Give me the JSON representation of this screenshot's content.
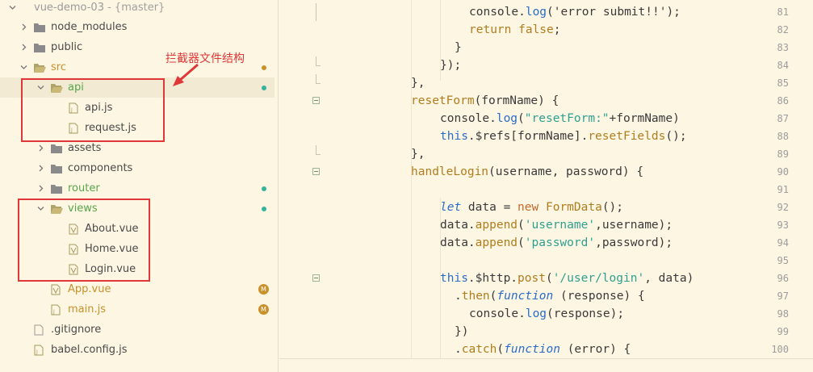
{
  "explorer": {
    "project": "vue-demo-03",
    "branch": " - {master}",
    "items": [
      {
        "label": "node_modules"
      },
      {
        "label": "public"
      },
      {
        "label": "src"
      },
      {
        "label": "api"
      },
      {
        "label": "api.js"
      },
      {
        "label": "request.js"
      },
      {
        "label": "assets"
      },
      {
        "label": "components"
      },
      {
        "label": "router"
      },
      {
        "label": "views"
      },
      {
        "label": "About.vue"
      },
      {
        "label": "Home.vue"
      },
      {
        "label": "Login.vue"
      },
      {
        "label": "App.vue"
      },
      {
        "label": "main.js"
      },
      {
        "label": ".gitignore"
      },
      {
        "label": "babel.config.js"
      }
    ],
    "badge_modified": "M",
    "annotation": "拦截器文件结构"
  },
  "editor": {
    "lines": [
      {
        "n": "81"
      },
      {
        "n": "82"
      },
      {
        "n": "83"
      },
      {
        "n": "84"
      },
      {
        "n": "85"
      },
      {
        "n": "86"
      },
      {
        "n": "87"
      },
      {
        "n": "88"
      },
      {
        "n": "89"
      },
      {
        "n": "90"
      },
      {
        "n": "91"
      },
      {
        "n": "92"
      },
      {
        "n": "93"
      },
      {
        "n": "94"
      },
      {
        "n": "95"
      },
      {
        "n": "96"
      },
      {
        "n": "97"
      },
      {
        "n": "98"
      },
      {
        "n": "99"
      },
      {
        "n": "100"
      }
    ],
    "tokens": {
      "l81_console": "console.",
      "l81_log": "log",
      "l81_str": "('error submit!!');",
      "l82_ret": "return ",
      "l82_false": "false",
      "l82_semi": ";",
      "l83": "}",
      "l84": "});",
      "l85": "},",
      "l86_fn": "resetForm",
      "l86_rest": "(formName) {",
      "l87_console": "console.",
      "l87_log": "log",
      "l87_open": "(",
      "l87_str": "\"resetForm:\"",
      "l87_rest": "+formName)",
      "l88_this": "this",
      "l88_mid": ".$refs[formName].",
      "l88_method": "resetFields",
      "l88_end": "();",
      "l89": "},",
      "l90_fn": "handleLogin",
      "l90_rest": "(username, password) {",
      "l92_let": "let",
      "l92_mid": " data = ",
      "l92_new": "new",
      "l92_cls": " FormData",
      "l92_end": "();",
      "l93_a": "data.",
      "l93_m": "append",
      "l93_o": "(",
      "l93_s": "'username'",
      "l93_e": ",username);",
      "l94_a": "data.",
      "l94_m": "append",
      "l94_o": "(",
      "l94_s": "'password'",
      "l94_e": ",password);",
      "l96_this": "this",
      "l96_mid": ".$http.",
      "l96_post": "post",
      "l96_o": "(",
      "l96_s": "'/user/login'",
      "l96_e": ", data)",
      "l97_dot": ".",
      "l97_then": "then",
      "l97_o": "(",
      "l97_fn": "function",
      "l97_e": " (response) {",
      "l98_c": "console.",
      "l98_log": "log",
      "l98_e": "(response);",
      "l99": "})",
      "l100_dot": ".",
      "l100_catch": "catch",
      "l100_o": "(",
      "l100_fn": "function",
      "l100_e": " (error) {"
    }
  },
  "colors": {
    "background": "#fdf6e3",
    "highlight_box": "#e03838",
    "git_added": "#36b39a",
    "git_modified": "#c8912b"
  }
}
